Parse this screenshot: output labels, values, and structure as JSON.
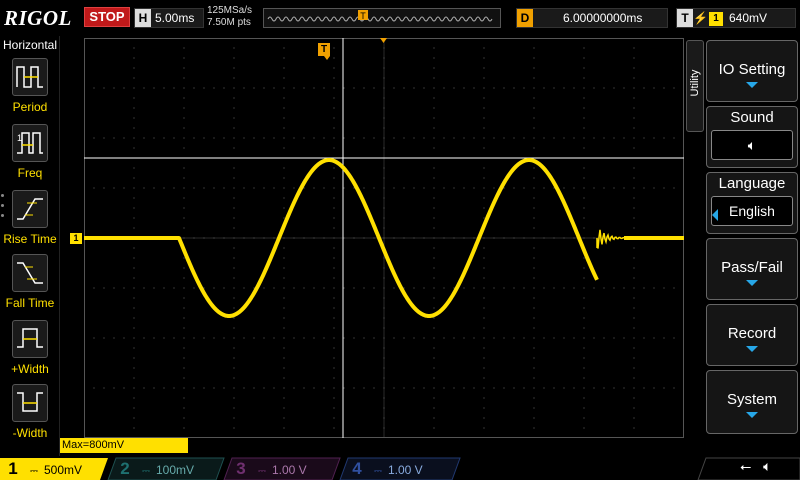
{
  "topbar": {
    "logo": "RIGOL",
    "run_state": "STOP",
    "horizontal_key": "H",
    "timebase": "5.00ms",
    "sample_rate": "125MSa/s",
    "memory_depth": "7.50M pts",
    "delay_key": "D",
    "delay_value": "6.00000000ms",
    "trigger_key": "T",
    "trigger_edge": "rising",
    "trigger_source": "1",
    "trigger_level": "640mV"
  },
  "left_panel": {
    "title": "Horizontal",
    "items": [
      {
        "label": "Period",
        "icon": "period-icon"
      },
      {
        "label": "Freq",
        "icon": "freq-icon"
      },
      {
        "label": "Rise Time",
        "icon": "rise-time-icon"
      },
      {
        "label": "Fall Time",
        "icon": "fall-time-icon"
      },
      {
        "label": "+Width",
        "icon": "positive-width-icon"
      },
      {
        "label": "-Width",
        "icon": "negative-width-icon"
      }
    ]
  },
  "right_panel": {
    "tab_label": "Utility",
    "io_setting": "IO Setting",
    "sound": "Sound",
    "sound_icon": "speaker-icon",
    "language": "Language",
    "language_value": "English",
    "pass_fail": "Pass/Fail",
    "record": "Record",
    "system": "System"
  },
  "cursor_readout": "Max=800mV",
  "channels": [
    {
      "num": "1",
      "scale": "500mV",
      "color": "#ffe000",
      "active": true
    },
    {
      "num": "2",
      "scale": "100mV",
      "color": "#00d0d0",
      "active": false
    },
    {
      "num": "3",
      "scale": "1.00 V",
      "color": "#d040d0",
      "active": false
    },
    {
      "num": "4",
      "scale": "1.00 V",
      "color": "#3080ff",
      "active": false
    }
  ],
  "status_icons": [
    "usb-icon",
    "speaker-icon"
  ],
  "colors": {
    "trace": "#ffe000",
    "trigger": "#f0a000",
    "stop": "#c0191a",
    "accent": "#27a7e8"
  },
  "markers": {
    "trigger_position": "T",
    "channel_ground": "1"
  }
}
